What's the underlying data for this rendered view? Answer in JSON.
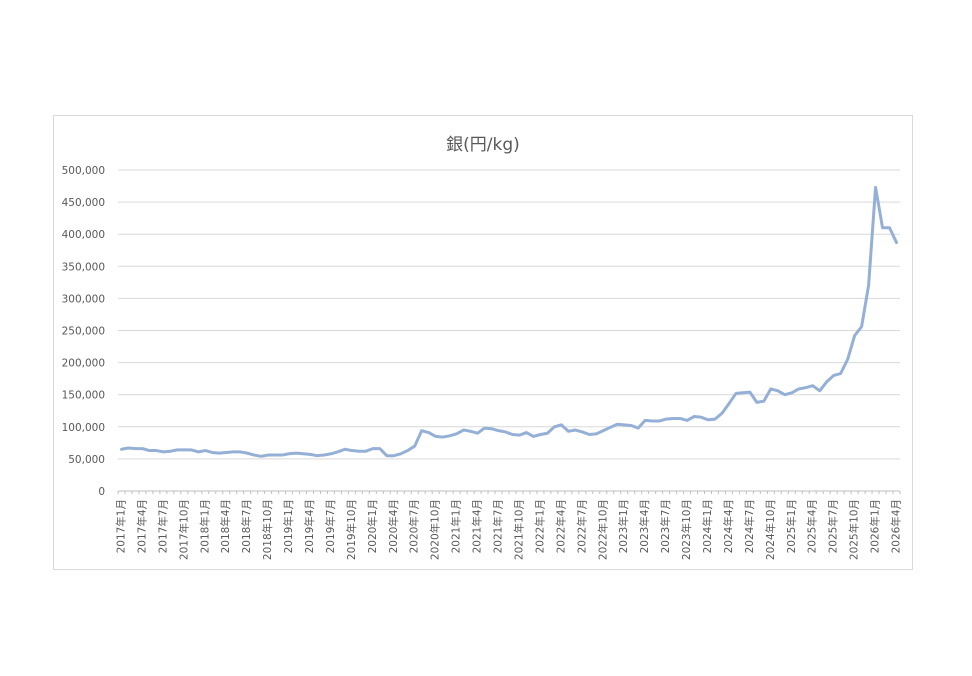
{
  "chart_data": {
    "type": "line",
    "title": "銀(円/kg)",
    "xlabel": "",
    "ylabel": "",
    "ylim": [
      0,
      500000
    ],
    "yticks": [
      "0",
      "50,000",
      "100,000",
      "150,000",
      "200,000",
      "250,000",
      "300,000",
      "350,000",
      "400,000",
      "450,000",
      "500,000"
    ],
    "grid": true,
    "legend": "none",
    "line_color": "#95b0d6",
    "x_tick_labels": [
      "2017年1月",
      "2017年4月",
      "2017年7月",
      "2017年10月",
      "2018年1月",
      "2018年4月",
      "2018年7月",
      "2018年10月",
      "2019年1月",
      "2019年4月",
      "2019年7月",
      "2019年10月",
      "2020年1月",
      "2020年4月",
      "2020年7月",
      "2020年10月",
      "2021年1月",
      "2021年4月",
      "2021年7月",
      "2021年10月",
      "2022年1月",
      "2022年4月",
      "2022年7月",
      "2022年10月",
      "2023年1月",
      "2023年4月",
      "2023年7月",
      "2023年10月",
      "2024年1月",
      "2024年4月",
      "2024年7月",
      "2024年10月",
      "2025年1月",
      "2025年4月",
      "2025年7月",
      "2025年10月",
      "2026年1月",
      "2026年4月"
    ],
    "series": [
      {
        "values": [
          65000,
          67000,
          66000,
          66000,
          63000,
          63000,
          61000,
          62000,
          64000,
          64000,
          64000,
          61000,
          63000,
          60000,
          59000,
          60000,
          61000,
          61000,
          59000,
          56000,
          54000,
          56000,
          56000,
          56000,
          58000,
          59000,
          58000,
          57000,
          55000,
          56000,
          58000,
          61000,
          65000,
          63000,
          62000,
          62000,
          66000,
          66000,
          55000,
          55000,
          58000,
          63000,
          70000,
          94000,
          91000,
          85000,
          84000,
          86000,
          89000,
          95000,
          93000,
          90000,
          98000,
          97000,
          94000,
          92000,
          88000,
          87000,
          91000,
          85000,
          88000,
          90000,
          100000,
          103000,
          93000,
          95000,
          92000,
          88000,
          89000,
          94000,
          99000,
          104000,
          103000,
          102000,
          98000,
          110000,
          109000,
          109000,
          112000,
          113000,
          113000,
          110000,
          116000,
          115000,
          111000,
          112000,
          121000,
          136000,
          152000,
          153000,
          154000,
          138000,
          140000,
          159000,
          156000,
          150000,
          153000,
          159000,
          161000,
          164000,
          156000,
          170000,
          180000,
          183000,
          205000,
          242000,
          256000,
          320000,
          473000,
          410000,
          410000,
          387000
        ]
      }
    ]
  }
}
